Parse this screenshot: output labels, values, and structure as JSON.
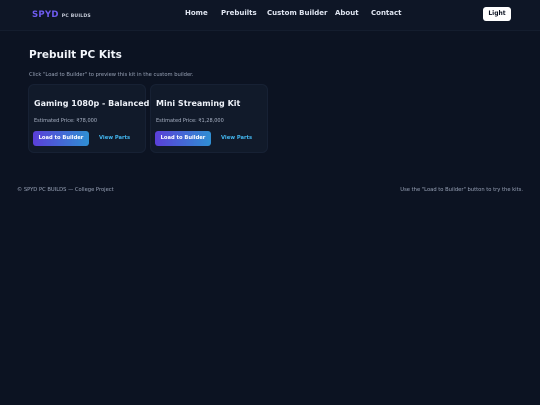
{
  "brand": {
    "main": "SPYD",
    "sub": "PC BUILDS"
  },
  "nav": {
    "items": [
      {
        "label": "Home"
      },
      {
        "label": "Prebuilts"
      },
      {
        "label": "Custom Builder"
      },
      {
        "label": "About"
      },
      {
        "label": "Contact"
      }
    ],
    "theme_toggle_label": "Light"
  },
  "main": {
    "title": "Prebuilt PC Kits",
    "subtitle": "Click \"Load to Builder\" to preview this kit in the custom builder.",
    "kits": [
      {
        "name": "Gaming 1080p - Balanced",
        "price": "Estimated Price: ₹78,000",
        "load_label": "Load to Builder",
        "view_label": "View Parts"
      },
      {
        "name": "Mini Streaming Kit",
        "price": "Estimated Price: ₹1,28,000",
        "load_label": "Load to Builder",
        "view_label": "View Parts"
      }
    ]
  },
  "footer": {
    "left": "© SPYD PC BUILDS — College Project",
    "right": "Use the \"Load to Builder\" button to try the kits."
  },
  "colors": {
    "background": "#0c1322",
    "card": "#111a2a",
    "brand_accent": "#6f5cf0",
    "button_gradient_start": "#5a3fd8",
    "button_gradient_end": "#2f8fd3",
    "link": "#43b7f0"
  }
}
